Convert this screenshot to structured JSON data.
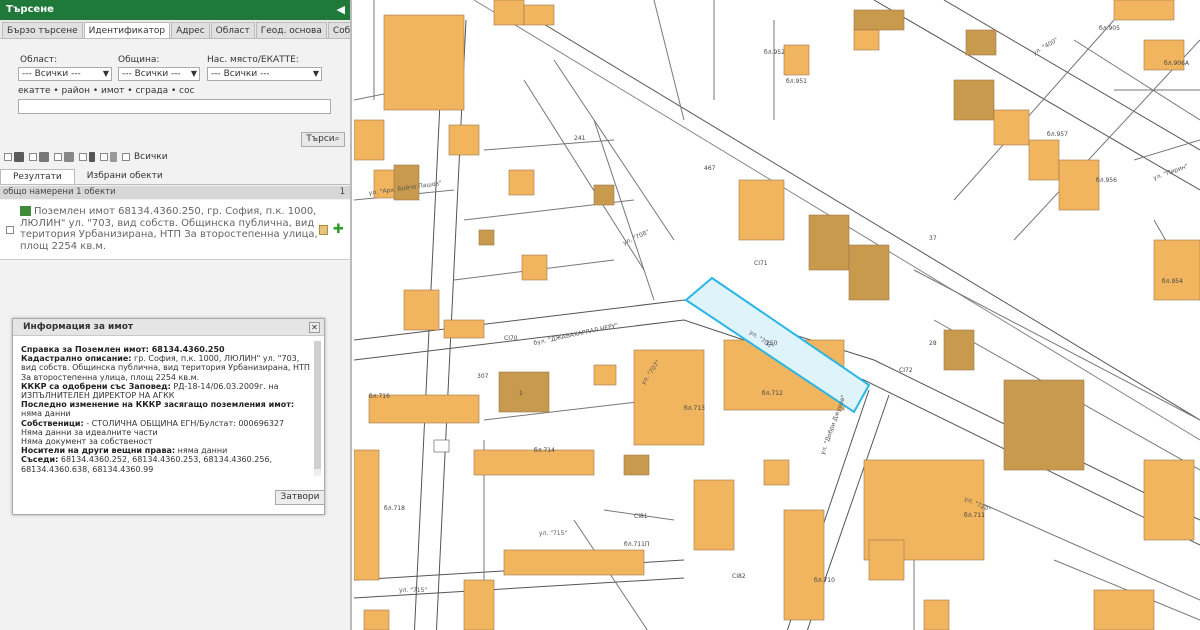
{
  "panel": {
    "title": "Търсене",
    "tabs": [
      "Бързо търсене",
      "Идентификатор",
      "Адрес",
      "Област",
      "Геод. основа",
      "Собственик"
    ],
    "active_tab": "Идентификатор"
  },
  "search": {
    "region_label": "Област:",
    "region_value": "--- Всички ---",
    "municipality_label": "Община:",
    "municipality_value": "--- Всички ---",
    "settlement_label": "Нас. място/ЕКАТТЕ:",
    "settlement_value": "--- Всички ---",
    "query_hint": "екатте • район • имот • сграда • сос",
    "query_value": "",
    "search_button": "Търси"
  },
  "filters": {
    "all_label": "Всички"
  },
  "results": {
    "tab_results": "Резултати",
    "tab_selected": "Избрани обекти",
    "found_text": "общо намерени 1 обекти",
    "found_count": "1",
    "item_text": "Поземлен имот 68134.4360.250, гр. София, п.к. 1000, ЛЮЛИН\" ул. \"703, вид собств. Общинска публична, вид територия Урбанизирана, НТП За второстепенна улица, площ 2254 кв.м."
  },
  "dialog": {
    "title": "Информация за имот",
    "ref_label": "Справка за Поземлен имот: 68134.4360.250",
    "cad_label": "Кадастрално описание:",
    "cad_text": "гр. София, п.к. 1000, ЛЮЛИН\" ул. \"703, вид собств. Общинска публична, вид територия Урбанизирана, НТП За второстепенна улица, площ 2254 кв.м.",
    "kkkr_label": "КККР са одобрени със Заповед:",
    "kkkr_text": "РД-18-14/06.03.2009г. на ИЗПЪЛНИТЕЛЕН ДИРЕКТОР НА АГКК",
    "last_label": "Последно изменение на КККР засягащо поземления имот:",
    "last_text": "няма данни",
    "owners_label": "Собственици:",
    "owners_text": "- СТОЛИЧНА ОБЩИНА ЕГН/Булстат: 000696327",
    "ideal_text": "Няма данни за идеалните части",
    "doc_text": "Няма документ за собственост",
    "holders_label": "Носители на други вещни права:",
    "holders_text": "няма данни",
    "neighbors_label": "Съседи:",
    "neighbors_text": "68134.4360.252, 68134.4360.253, 68134.4360.256, 68134.4360.638, 68134.4360.99",
    "close_button": "Затвори"
  },
  "map": {
    "street_labels": [
      "бул. \"ДЖАВАХАРЛАЛ НЕРУ\"",
      "ул. \"703\"",
      "ул. \"707\"",
      "ул. \"708\"",
      "ул. \"715\"",
      "ул. \"715\"",
      "ул. \"Добри Джуров\"",
      "ул. \"720\"",
      "ул. \"Пирин\"",
      "ул. \"Арх. Бойчо Пашов\"",
      "ул. \"400\""
    ],
    "block_labels": [
      "бл.713",
      "бл.712",
      "бл.716",
      "бл.718",
      "бл.714",
      "бл.710",
      "бл.711",
      "бл.711П",
      "бл.957",
      "бл.956",
      "бл.954",
      "бл.952",
      "бл.951",
      "бл.905",
      "бл.906А"
    ],
    "parcel_labels": [
      "250",
      "307",
      "1",
      "241",
      "467",
      "37",
      "28",
      "CI70",
      "CI71",
      "CI72",
      "CI81",
      "CI82"
    ],
    "highlight_color": "#29b6e6"
  }
}
